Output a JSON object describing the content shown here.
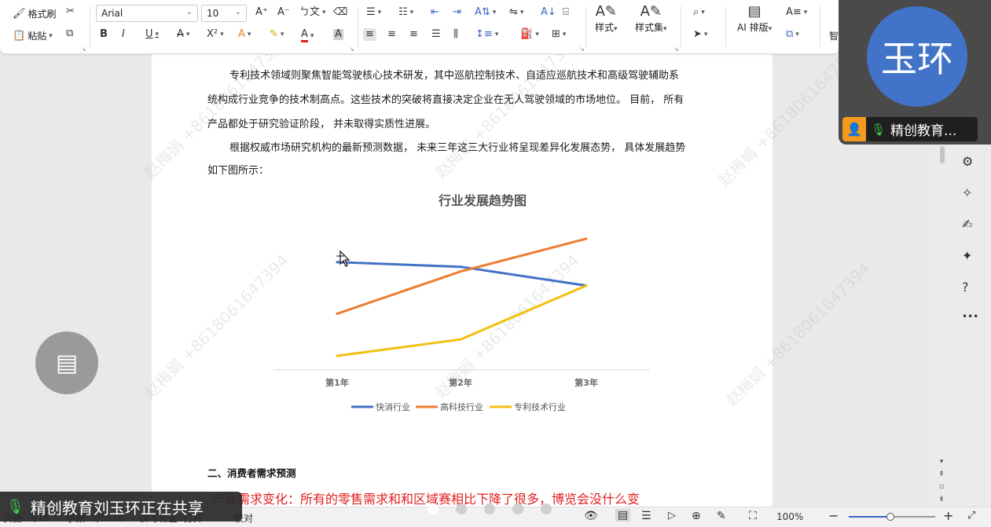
{
  "ribbon": {
    "format_painter": "格式刷",
    "paste": "粘贴",
    "font_name": "Arial",
    "font_size": "10",
    "styles": "样式",
    "style_set": "样式集",
    "ai_layout": "AI 排版",
    "cut_label": "智"
  },
  "document": {
    "para1_line1": "专利技术领域则聚焦智能驾驶核心技术研发，其中巡航控制技术、自适应巡航技术和高级驾驶辅助系",
    "para1_line2": "统构成行业竞争的技术制高点。这些技术的突破将直接决定企业在无人驾驶领域的市场地位。 目前， 所有",
    "para1_line3": "产品都处于研究验证阶段， 并未取得实质性进展。",
    "para2_line1": "根据权威市场研究机构的最新预测数据， 未来三年这三大行业将呈现差异化发展态势， 具体发展趋势",
    "para2_line2": "如下图所示：",
    "heading2": "二、消费者需求预测",
    "red_line": "产品需求变化：所有的零售需求和和区域赛相比下降了很多，博览会没什么变"
  },
  "chart_data": {
    "type": "line",
    "title": "行业发展趋势图",
    "categories": [
      "第1年",
      "第2年",
      "第3年"
    ],
    "series": [
      {
        "name": "快消行业",
        "color": "#4472c4",
        "values": [
          4.6,
          4.4,
          3.6
        ]
      },
      {
        "name": "高科技行业",
        "color": "#ed7d31",
        "values": [
          2.4,
          4.2,
          5.6
        ]
      },
      {
        "name": "专利技术行业",
        "color": "#f2c010",
        "values": [
          0.6,
          1.3,
          3.6
        ]
      }
    ],
    "ylim": [
      0,
      6
    ],
    "grid": false,
    "legend": "bottom"
  },
  "video": {
    "avatar_text": "玉环",
    "name": "精创教育..."
  },
  "share_banner": "精创教育刘玉环正在共享",
  "status": {
    "page": "页面: 3/16",
    "words": "字数: 1/5916",
    "spell": "拼写检查: 打开",
    "proof": "校对",
    "zoom": "100%"
  },
  "watermark": "赵梅娟 +8618061647394"
}
